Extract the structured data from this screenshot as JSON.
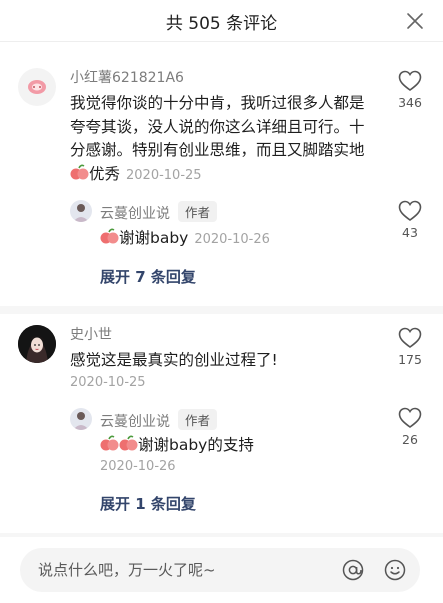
{
  "header": {
    "title": "共 505 条评论"
  },
  "comments": [
    {
      "username": "小红薯621821A6",
      "text": "我觉得你谈的十分中肯，我听过很多人都是夸夸其谈，没人说的你这么详细且可行。十分感谢。特别有创业思维，而且又脚踏实地",
      "text_tail": "优秀",
      "time": "2020-10-25",
      "likes": "346",
      "reply": {
        "username": "云蔓创业说",
        "badge": "作者",
        "text": "谢谢baby",
        "time": "2020-10-26",
        "likes": "43"
      },
      "expand": "展开 7 条回复"
    },
    {
      "username": "史小世",
      "text": "感觉这是最真实的创业过程了!",
      "time": "2020-10-25",
      "likes": "175",
      "reply": {
        "username": "云蔓创业说",
        "badge": "作者",
        "text": "谢谢baby的支持",
        "time": "2020-10-26",
        "likes": "26"
      },
      "expand": "展开 1 条回复"
    }
  ],
  "input": {
    "placeholder": "说点什么吧，万一火了呢~"
  },
  "icons": {
    "close": "close-icon",
    "like": "heart-outline-icon",
    "mention": "at-icon",
    "emoji": "smile-icon",
    "sticker": "peach-emoji-icon"
  },
  "colors": {
    "expand_link": "#33456b",
    "meta_gray": "#a3a3a3",
    "divider": "#f6f6f6"
  }
}
